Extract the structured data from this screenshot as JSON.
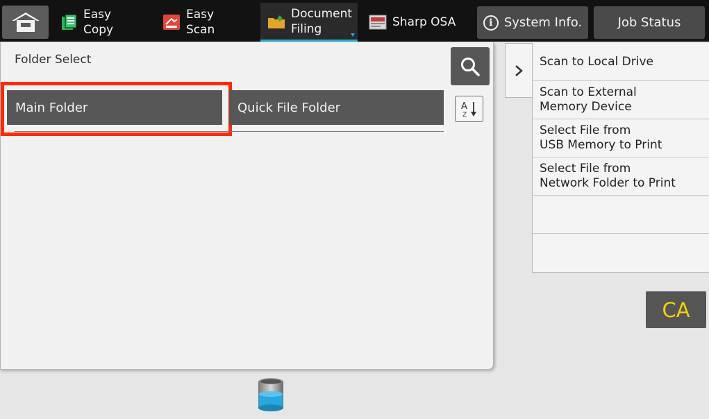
{
  "top_nav": {
    "tabs": [
      {
        "label": "Easy\nCopy",
        "icon": "easy-copy-icon"
      },
      {
        "label": "Easy\nScan",
        "icon": "easy-scan-icon"
      },
      {
        "label": "Document\nFiling",
        "icon": "document-filing-icon",
        "active": true
      },
      {
        "label": "Sharp OSA",
        "icon": "sharp-osa-icon"
      }
    ],
    "system_info_label": "System Info.",
    "job_status_label": "Job Status"
  },
  "folder_panel": {
    "title": "Folder Select",
    "folders": [
      {
        "label": "Main Folder",
        "highlighted": true
      },
      {
        "label": "Quick File Folder"
      }
    ]
  },
  "action_panel": {
    "items": [
      "Scan to Local Drive",
      "Scan to External\nMemory Device",
      "Select File from\nUSB Memory to Print",
      "Select File from\nNetwork Folder to Print",
      "",
      ""
    ]
  },
  "ca_label": "CA",
  "colors": {
    "highlight": "#ff2a0a",
    "active_tab_underline": "#28a9d6",
    "ca_text": "#f4d100"
  }
}
